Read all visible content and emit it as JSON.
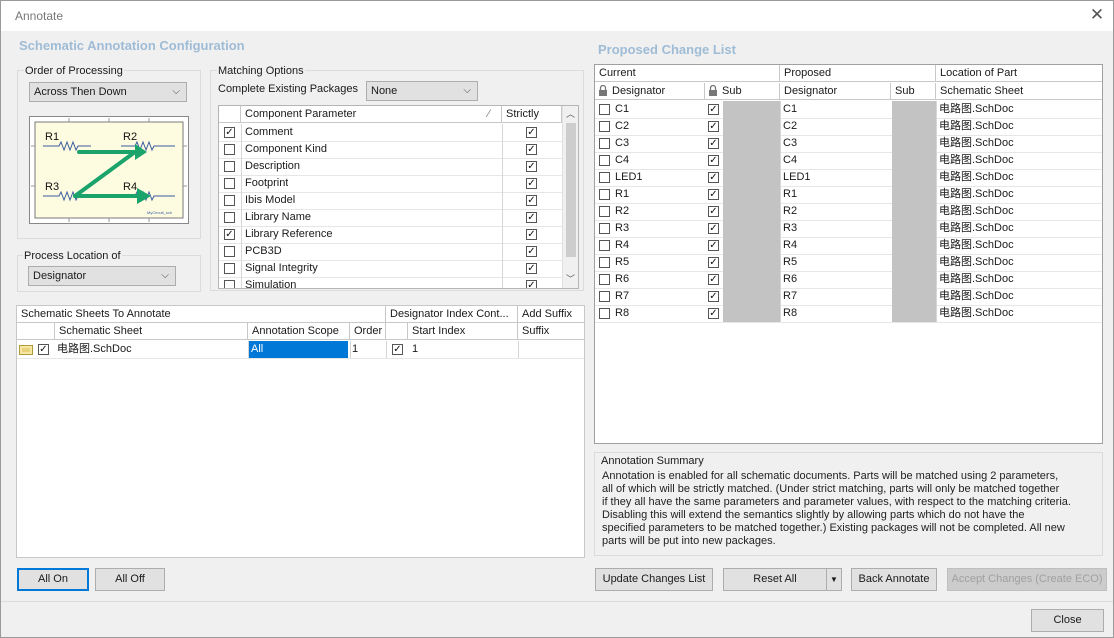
{
  "window": {
    "title": "Annotate"
  },
  "left": {
    "section_title": "Schematic Annotation Configuration",
    "order": {
      "label": "Order of Processing",
      "value": "Across Then Down"
    },
    "diagram": {
      "r1": "R1",
      "r2": "R2",
      "r3": "R3",
      "r4": "R4",
      "footer": "MyCircuit_sch"
    },
    "process_location": {
      "label": "Process Location of",
      "value": "Designator"
    },
    "matching": {
      "label": "Matching Options",
      "complete_label": "Complete Existing Packages",
      "complete_value": "None",
      "col_param": "Component Parameter",
      "col_strict": "Strictly",
      "rows": [
        {
          "name": "Comment",
          "checked": true,
          "strict": true
        },
        {
          "name": "Component Kind",
          "checked": false,
          "strict": true
        },
        {
          "name": "Description",
          "checked": false,
          "strict": true
        },
        {
          "name": "Footprint",
          "checked": false,
          "strict": true
        },
        {
          "name": "Ibis Model",
          "checked": false,
          "strict": true
        },
        {
          "name": "Library Name",
          "checked": false,
          "strict": true
        },
        {
          "name": "Library Reference",
          "checked": true,
          "strict": true
        },
        {
          "name": "PCB3D",
          "checked": false,
          "strict": true
        },
        {
          "name": "Signal Integrity",
          "checked": false,
          "strict": true
        },
        {
          "name": "Simulation",
          "checked": false,
          "strict": true
        }
      ]
    },
    "sheets": {
      "group1": "Schematic Sheets To Annotate",
      "group2": "Designator Index Cont...",
      "group3": "Add Suffix",
      "col_sheet": "Schematic Sheet",
      "col_scope": "Annotation Scope",
      "col_order": "Order",
      "col_start": "Start Index",
      "col_suffix": "Suffix",
      "row": {
        "sheet": "电路图.SchDoc",
        "scope": "All",
        "order": "1",
        "start": "1"
      }
    },
    "all_on": "All On",
    "all_off": "All Off"
  },
  "right": {
    "section_title": "Proposed Change List",
    "group_current": "Current",
    "group_proposed": "Proposed",
    "group_location": "Location of Part",
    "col_designator": "Designator",
    "col_sub": "Sub",
    "col_sheet": "Schematic Sheet",
    "rows": [
      {
        "current": "C1",
        "proposed": "C1",
        "sheet": "电路图.SchDoc"
      },
      {
        "current": "C2",
        "proposed": "C2",
        "sheet": "电路图.SchDoc"
      },
      {
        "current": "C3",
        "proposed": "C3",
        "sheet": "电路图.SchDoc"
      },
      {
        "current": "C4",
        "proposed": "C4",
        "sheet": "电路图.SchDoc"
      },
      {
        "current": "LED1",
        "proposed": "LED1",
        "sheet": "电路图.SchDoc"
      },
      {
        "current": "R1",
        "proposed": "R1",
        "sheet": "电路图.SchDoc"
      },
      {
        "current": "R2",
        "proposed": "R2",
        "sheet": "电路图.SchDoc"
      },
      {
        "current": "R3",
        "proposed": "R3",
        "sheet": "电路图.SchDoc"
      },
      {
        "current": "R4",
        "proposed": "R4",
        "sheet": "电路图.SchDoc"
      },
      {
        "current": "R5",
        "proposed": "R5",
        "sheet": "电路图.SchDoc"
      },
      {
        "current": "R6",
        "proposed": "R6",
        "sheet": "电路图.SchDoc"
      },
      {
        "current": "R7",
        "proposed": "R7",
        "sheet": "电路图.SchDoc"
      },
      {
        "current": "R8",
        "proposed": "R8",
        "sheet": "电路图.SchDoc"
      }
    ],
    "summary": {
      "title": "Annotation Summary",
      "lines": [
        "Annotation is enabled for all schematic documents. Parts will be matched using 2 parameters,",
        "all of which will be strictly matched. (Under strict matching, parts will only be matched together",
        "if they all have the same parameters and parameter values, with respect to the matching criteria.",
        "Disabling this will extend the semantics slightly by allowing parts which do not have the",
        "specified parameters to be matched together.) Existing packages will not be completed. All new",
        "parts will be put into new packages."
      ]
    },
    "update_changes": "Update Changes List",
    "reset_all": "Reset All",
    "back_annotate": "Back Annotate",
    "accept_changes": "Accept Changes (Create ECO)"
  },
  "close_button": "Close",
  "colors": {
    "accent": "#0078d7",
    "section_title": "#9fbcd6",
    "diagram_arrow": "#1aa36b",
    "diagram_bg": "#fdfbe0"
  }
}
